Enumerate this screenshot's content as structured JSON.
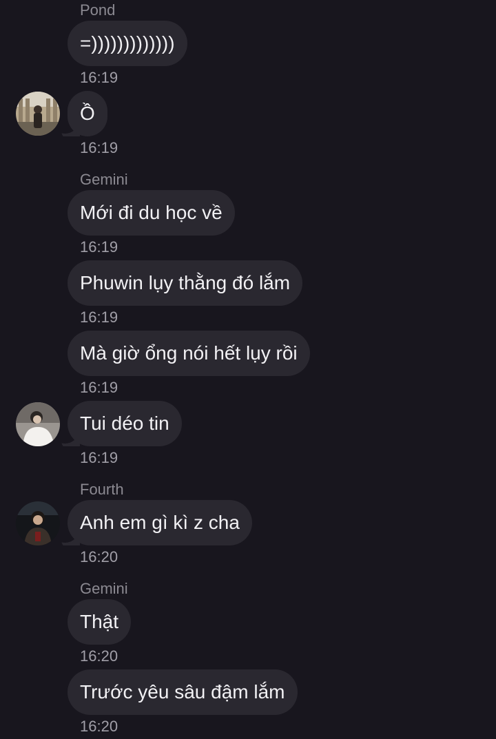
{
  "messages": [
    {
      "sender": "Pond",
      "text": "=)))))))))))))",
      "time": "16:19"
    },
    {
      "sender": "",
      "text": "Ồ",
      "time": "16:19",
      "avatar": "avatar-photo-building"
    },
    {
      "sender": "Gemini",
      "text": "Mới đi du học về",
      "time": "16:19"
    },
    {
      "sender": "",
      "text": "Phuwin lụy thằng đó lắm",
      "time": "16:19"
    },
    {
      "sender": "",
      "text": "Mà giờ ổng nói hết lụy rồi",
      "time": "16:19"
    },
    {
      "sender": "",
      "text": "Tui déo tin",
      "time": "16:19",
      "avatar": "avatar-photo-white-shirt"
    },
    {
      "sender": "Fourth",
      "text": "Anh em gì kì z cha",
      "time": "16:20",
      "avatar": "avatar-photo-dark"
    },
    {
      "sender": "Gemini",
      "text": "Thật",
      "time": "16:20"
    },
    {
      "sender": "",
      "text": "Trước yêu sâu đậm lắm",
      "time": "16:20"
    }
  ],
  "colors": {
    "background": "#18161e",
    "bubble": "#2a2830",
    "text": "#f2f1f4",
    "meta": "#8c8a92"
  }
}
